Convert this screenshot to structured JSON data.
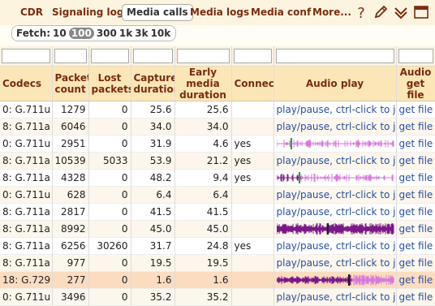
{
  "nav": {
    "tabs": [
      {
        "label": "CDR",
        "active": false
      },
      {
        "label": "Signaling logs",
        "active": false
      },
      {
        "label": "Media calls",
        "active": true
      },
      {
        "label": "Media logs",
        "active": false
      },
      {
        "label": "Media conf",
        "active": false
      },
      {
        "label": "More...",
        "active": false
      }
    ],
    "icons": [
      "help-icon",
      "edit-icon",
      "expand-icon",
      "window-icon"
    ]
  },
  "fetch": {
    "label": "Fetch:",
    "options": [
      "10",
      "100",
      "300",
      "1k",
      "3k",
      "10k"
    ],
    "selected": "100"
  },
  "columns": [
    "Codecs",
    "Packet count",
    "Lost packets",
    "Captured duration",
    "Early media duration",
    "Connect",
    "Audio play",
    "Audio get file"
  ],
  "rows": [
    {
      "codec": "0: G.711u",
      "packets": "1279",
      "lost": "0",
      "captured": "25.6",
      "early": "25.6",
      "connect": "",
      "audio": "text",
      "play": "play/pause, ctrl-click to jump",
      "getfile": "get file"
    },
    {
      "codec": "8: G.711a",
      "packets": "6046",
      "lost": "0",
      "captured": "34.0",
      "early": "34.0",
      "connect": "",
      "audio": "text",
      "play": "play/pause, ctrl-click to jump",
      "getfile": "get file"
    },
    {
      "codec": "0: G.711u",
      "packets": "2951",
      "lost": "0",
      "captured": "31.9",
      "early": "4.6",
      "connect": "yes",
      "audio": "wave-pink",
      "play": "",
      "getfile": "get file"
    },
    {
      "codec": "8: G.711a",
      "packets": "10539",
      "lost": "5033",
      "captured": "53.9",
      "early": "21.2",
      "connect": "yes",
      "audio": "text",
      "play": "play/pause, ctrl-click to jump",
      "getfile": "get file"
    },
    {
      "codec": "8: G.711a",
      "packets": "4328",
      "lost": "0",
      "captured": "48.2",
      "early": "9.4",
      "connect": "yes",
      "audio": "wave-mixed",
      "play": "",
      "getfile": "get file"
    },
    {
      "codec": "0: G.711u",
      "packets": "628",
      "lost": "0",
      "captured": "6.4",
      "early": "6.4",
      "connect": "",
      "audio": "text",
      "play": "play/pause, ctrl-click to jump",
      "getfile": "get file"
    },
    {
      "codec": "8: G.711a",
      "packets": "2817",
      "lost": "0",
      "captured": "41.5",
      "early": "41.5",
      "connect": "",
      "audio": "text",
      "play": "play/pause, ctrl-click to jump",
      "getfile": "get file"
    },
    {
      "codec": "8: G.711a",
      "packets": "8992",
      "lost": "0",
      "captured": "45.0",
      "early": "45.0",
      "connect": "",
      "audio": "wave-purple",
      "play": "",
      "getfile": "get file"
    },
    {
      "codec": "8: G.711a",
      "packets": "6256",
      "lost": "30260",
      "captured": "31.7",
      "early": "24.8",
      "connect": "yes",
      "audio": "text",
      "play": "play/pause, ctrl-click to jump",
      "getfile": "get file"
    },
    {
      "codec": "8: G.711a",
      "packets": "977",
      "lost": "0",
      "captured": "19.5",
      "early": "19.5",
      "connect": "",
      "audio": "text",
      "play": "play/pause, ctrl-click to jump",
      "getfile": "get file"
    },
    {
      "codec": "18: G.729",
      "packets": "277",
      "lost": "0",
      "captured": "1.6",
      "early": "1.6",
      "connect": "",
      "audio": "wave-purple2",
      "play": "",
      "getfile": "get file"
    },
    {
      "codec": "0: G.711u",
      "packets": "3496",
      "lost": "0",
      "captured": "35.2",
      "early": "35.2",
      "connect": "",
      "audio": "text",
      "play": "play/pause, ctrl-click to jump",
      "getfile": "get file"
    }
  ],
  "colors": {
    "accent": "#7a2c10",
    "header_bg": "#fbe6b8",
    "link": "#2a4fa0",
    "wave_pink": "#d77ad8",
    "wave_purple": "#7a1a86",
    "wave_marker": "#22aa22"
  }
}
